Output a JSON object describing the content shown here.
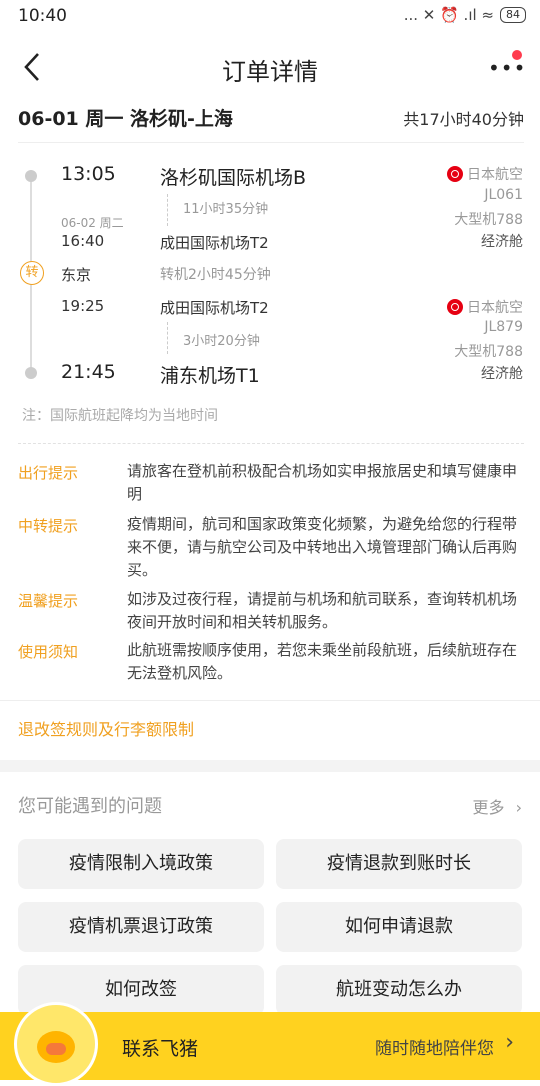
{
  "status": {
    "time": "10:40",
    "signal_icons": "... ✕ ⏰ .ıl ≈",
    "battery": "84"
  },
  "nav": {
    "title": "订单详情"
  },
  "route": {
    "title": "06-01 周一 洛杉矶-上海",
    "duration": "共17小时40分钟"
  },
  "segments": [
    {
      "dep_time": "13:05",
      "dep_airport": "洛杉矶国际机场B",
      "flight_dur": "11小时35分钟",
      "arr_date": "06-02 周二",
      "arr_time": "16:40",
      "arr_airport": "成田国际机场T2",
      "airline": "日本航空",
      "flight_no": "JL061",
      "aircraft": "大型机788",
      "cabin": "经济舱"
    },
    {
      "dep_time": "19:25",
      "dep_airport": "成田国际机场T2",
      "flight_dur": "3小时20分钟",
      "arr_time": "21:45",
      "arr_airport": "浦东机场T1",
      "airline": "日本航空",
      "flight_no": "JL879",
      "aircraft": "大型机788",
      "cabin": "经济舱"
    }
  ],
  "transfer": {
    "badge": "转",
    "city": "东京",
    "info": "转机2小时45分钟"
  },
  "note": "注：国际航班起降均为当地时间",
  "tips": [
    {
      "label": "出行提示",
      "text": "请旅客在登机前积极配合机场如实申报旅居史和填写健康申明"
    },
    {
      "label": "中转提示",
      "text": "疫情期间，航司和国家政策变化频繁，为避免给您的行程带来不便，请与航空公司及中转地出入境管理部门确认后再购买。"
    },
    {
      "label": "温馨提示",
      "text": "如涉及过夜行程，请提前与机场和航司联系，查询转机机场夜间开放时间和相关转机服务。"
    },
    {
      "label": "使用须知",
      "text": "此航班需按顺序使用，若您未乘坐前段航班，后续航班存在无法登机风险。"
    }
  ],
  "rules_link": "退改签规则及行李额限制",
  "faq": {
    "title": "您可能遇到的问题",
    "more": "更多",
    "items": [
      "疫情限制入境政策",
      "疫情退款到账时长",
      "疫情机票退订政策",
      "如何申请退款",
      "如何改签",
      "航班变动怎么办"
    ]
  },
  "footer": {
    "contact": "联系飞猪",
    "slogan": "随时随地陪伴您"
  },
  "colors": {
    "accent": "#f0a020",
    "brand_yellow": "#ffd21f",
    "airline_red": "#e60012"
  }
}
